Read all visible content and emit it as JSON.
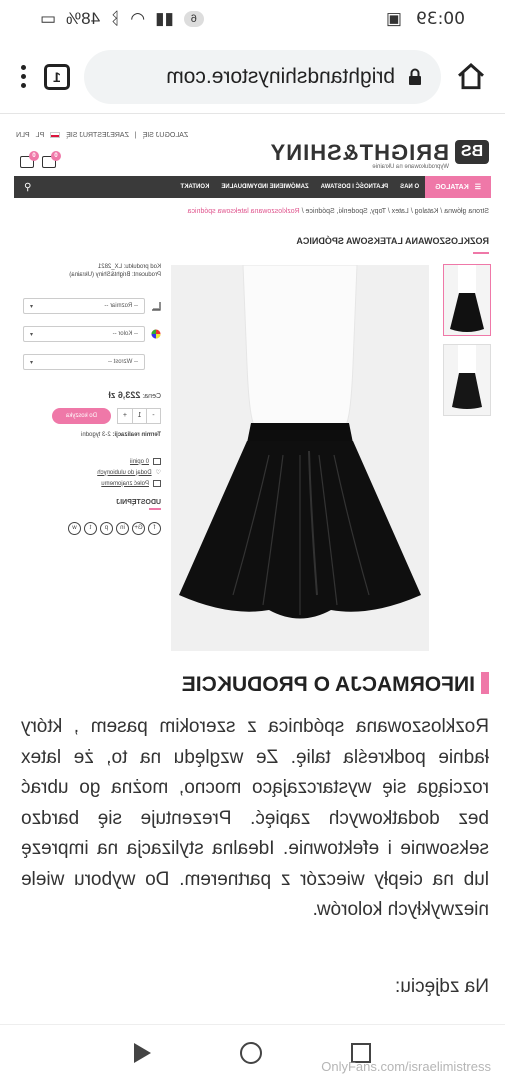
{
  "status_bar": {
    "time": "00:39",
    "battery": "48%",
    "notif_count": "6"
  },
  "browser": {
    "url": "brightandshinystore.com",
    "tab_count": "1"
  },
  "site": {
    "logo_word": "BRIGHT&SHINY",
    "logo_mark": "BS",
    "logo_tagline": "Wyprodukowane na Ukrainie",
    "top_links": [
      "ZALOGUJ SIĘ",
      "ZAREJESTRUJ SIĘ",
      "PL",
      "PLN"
    ],
    "cart_count": "0",
    "wish_count": "0"
  },
  "nav": {
    "katalog": "KATALOG",
    "items": [
      "O NAS",
      "PŁATNOŚĆ I DOSTAWA",
      "ZAMÓWIENIE INDYWIDUALNE",
      "KONTAKT"
    ]
  },
  "breadcrumbs": {
    "items": [
      "Strona główna",
      "Katalog",
      "Latex",
      "Topy, Spodenki, Spódnice"
    ],
    "last": "Rozkloszowana lateksowa spódnica"
  },
  "product": {
    "title": "ROZKLOSZOWANA LATEKSOWA SPÓDNICA",
    "code": "Kod produktu: LX_2821",
    "producer": "Producent: Bright&Shiny (Ukraina)",
    "selects": [
      {
        "label": "-- Rozmiar --",
        "icon": "ruler-icon"
      },
      {
        "label": "-- Kolor --",
        "icon": "color-wheel-icon"
      },
      {
        "label": "-- Wzrost --",
        "icon": "none"
      }
    ],
    "price_label": "Cena:",
    "price": "223,6 zł",
    "qty_minus": "-",
    "qty_value": "1",
    "qty_plus": "+",
    "add_to_cart": "Do koszyka",
    "lead_time_label": "Termin realizacji:",
    "lead_time": "2-3 tygodni",
    "reviews": "0 opinii",
    "wishlist": "Dodaj do ulubionych",
    "recommend": "Poleć znajomemu",
    "share": "UDOSTĘPNIJ",
    "socials": [
      "f",
      "G+",
      "in",
      "p",
      "t",
      "w"
    ]
  },
  "info": {
    "heading": "INFORMACJA O PRODUKCIE",
    "description": "Rozkloszowana spódnica z szerokim pasem , który ładnie podkreśla talię. Ze względu na to, że latex rozciąga się wystarczająco mocno, można go ubrać bez dodatkowych zapięć. Prezentuje się bardzo seksownie i efektownie. Idealna stylizacja na imprezę lub na ciepły wieczór z partnerem. Do wyboru wiele niezwykłych kolorów.",
    "photo_caption": "Na zdjęciu:"
  },
  "watermark": "OnlyFans.com/israelimistress"
}
